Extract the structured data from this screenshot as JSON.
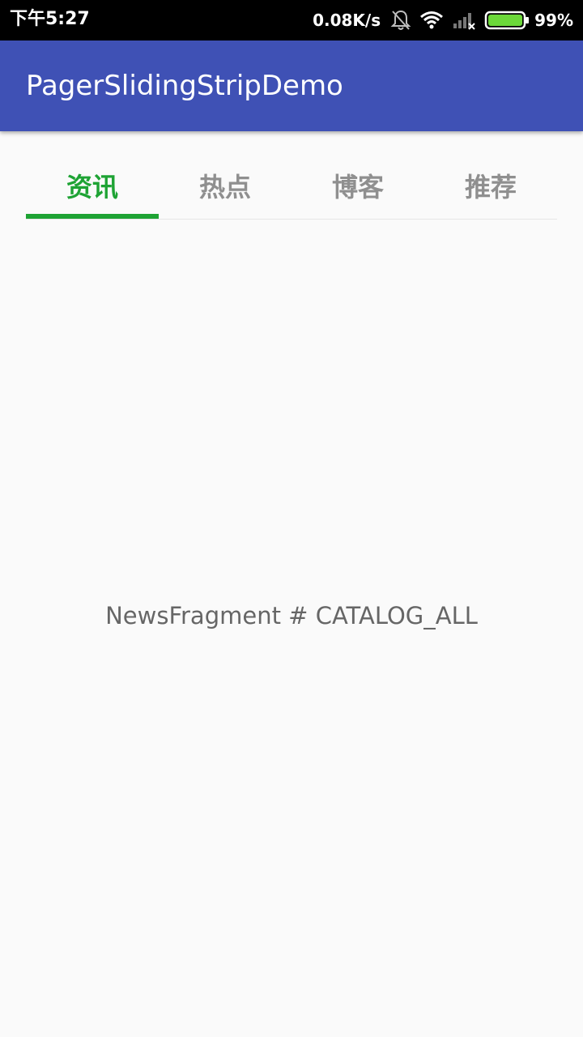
{
  "status_bar": {
    "time": "下午5:27",
    "net_speed": "0.08K/s",
    "battery_percent": "99%",
    "battery_color": "#6cd83a",
    "icons": [
      "bell-muted-icon",
      "wifi-icon",
      "signal-icon",
      "battery-icon"
    ]
  },
  "app_bar": {
    "title": "PagerSlidingStripDemo",
    "color": "#3f51b5"
  },
  "tabs": {
    "items": [
      {
        "label": "资讯",
        "active": true
      },
      {
        "label": "热点",
        "active": false
      },
      {
        "label": "博客",
        "active": false
      },
      {
        "label": "推荐",
        "active": false
      }
    ],
    "active_color": "#1ea334",
    "inactive_color": "#8f8f8f"
  },
  "content": {
    "text": "NewsFragment # CATALOG_ALL"
  }
}
